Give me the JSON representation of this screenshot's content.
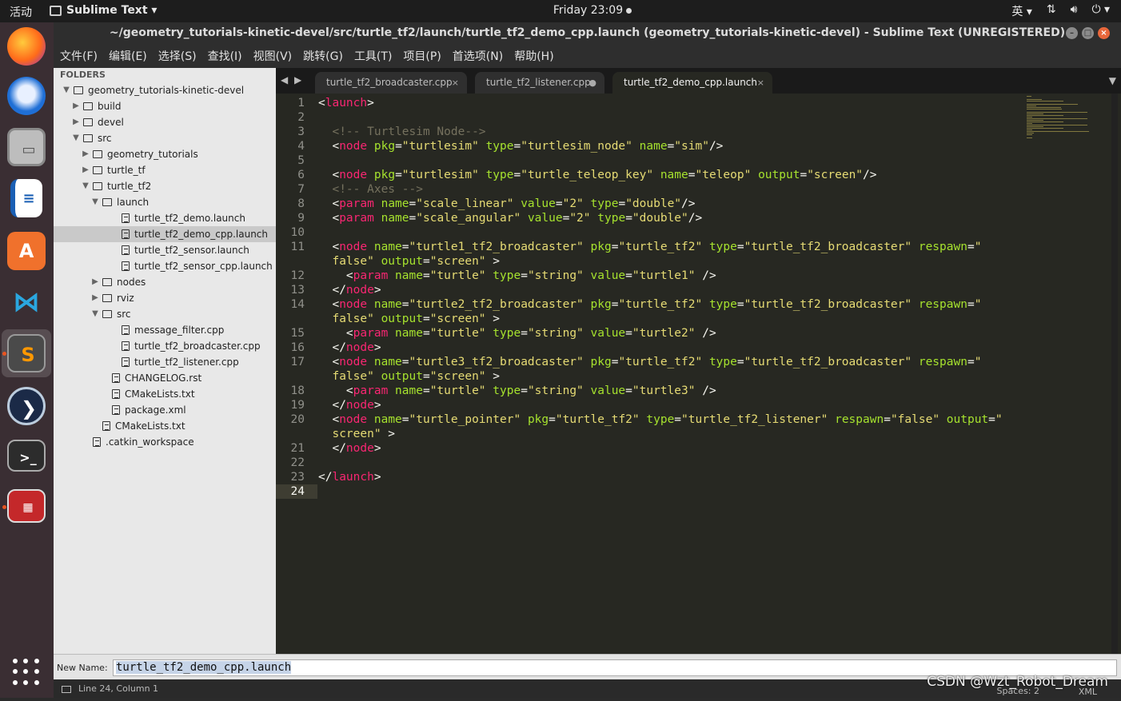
{
  "topbar": {
    "activities": "活动",
    "app_name": "Sublime Text ▾",
    "clock": "Friday 23:09",
    "ime": "英 ▾",
    "tray_icons": [
      "network-icon",
      "volume-icon",
      "power-icon"
    ]
  },
  "window": {
    "title": "~/geometry_tutorials-kinetic-devel/src/turtle_tf2/launch/turtle_tf2_demo_cpp.launch (geometry_tutorials-kinetic-devel) - Sublime Text (UNREGISTERED)"
  },
  "menu": [
    "文件(F)",
    "编辑(E)",
    "选择(S)",
    "查找(I)",
    "视图(V)",
    "跳转(G)",
    "工具(T)",
    "项目(P)",
    "首选项(N)",
    "帮助(H)"
  ],
  "dock": [
    "firefox-icon",
    "thunderbird-icon",
    "files-icon",
    "writer-icon",
    "software-icon",
    "vscode-icon",
    "sublime-icon",
    "qtcreator-icon",
    "terminal-icon",
    "terminator-icon"
  ],
  "sidebar": {
    "header": "FOLDERS",
    "tree": [
      {
        "label": "geometry_tutorials-kinetic-devel",
        "depth": 0,
        "kind": "folder",
        "open": true
      },
      {
        "label": "build",
        "depth": 1,
        "kind": "folder",
        "open": false
      },
      {
        "label": "devel",
        "depth": 1,
        "kind": "folder",
        "open": false
      },
      {
        "label": "src",
        "depth": 1,
        "kind": "folder",
        "open": true
      },
      {
        "label": "geometry_tutorials",
        "depth": 2,
        "kind": "folder",
        "open": false
      },
      {
        "label": "turtle_tf",
        "depth": 2,
        "kind": "folder",
        "open": false
      },
      {
        "label": "turtle_tf2",
        "depth": 2,
        "kind": "folder",
        "open": true
      },
      {
        "label": "launch",
        "depth": 3,
        "kind": "folder",
        "open": true
      },
      {
        "label": "turtle_tf2_demo.launch",
        "depth": 4,
        "kind": "file"
      },
      {
        "label": "turtle_tf2_demo_cpp.launch",
        "depth": 4,
        "kind": "file",
        "selected": true
      },
      {
        "label": "turtle_tf2_sensor.launch",
        "depth": 4,
        "kind": "file"
      },
      {
        "label": "turtle_tf2_sensor_cpp.launch",
        "depth": 4,
        "kind": "file"
      },
      {
        "label": "nodes",
        "depth": 3,
        "kind": "folder",
        "open": false
      },
      {
        "label": "rviz",
        "depth": 3,
        "kind": "folder",
        "open": false
      },
      {
        "label": "src",
        "depth": 3,
        "kind": "folder",
        "open": true
      },
      {
        "label": "message_filter.cpp",
        "depth": 4,
        "kind": "file"
      },
      {
        "label": "turtle_tf2_broadcaster.cpp",
        "depth": 4,
        "kind": "file"
      },
      {
        "label": "turtle_tf2_listener.cpp",
        "depth": 4,
        "kind": "file"
      },
      {
        "label": "CHANGELOG.rst",
        "depth": 3,
        "kind": "file"
      },
      {
        "label": "CMakeLists.txt",
        "depth": 3,
        "kind": "file"
      },
      {
        "label": "package.xml",
        "depth": 3,
        "kind": "file"
      },
      {
        "label": "CMakeLists.txt",
        "depth": 2,
        "kind": "file"
      },
      {
        "label": ".catkin_workspace",
        "depth": 1,
        "kind": "file"
      }
    ]
  },
  "tabs": [
    {
      "label": "turtle_tf2_broadcaster.cpp",
      "close": "×",
      "active": false
    },
    {
      "label": "turtle_tf2_listener.cpp",
      "close": "●",
      "active": false
    },
    {
      "label": "turtle_tf2_demo_cpp.launch",
      "close": "×",
      "active": true
    }
  ],
  "editor": {
    "current_line": 24,
    "lines": [
      {
        "n": "1",
        "tokens": [
          [
            "p",
            "<"
          ],
          [
            "tg",
            "launch"
          ],
          [
            "p",
            ">"
          ]
        ]
      },
      {
        "n": "2",
        "tokens": []
      },
      {
        "n": "3",
        "tokens": [
          [
            "p",
            "  "
          ],
          [
            "cm",
            "<!-- Turtlesim Node-->"
          ]
        ]
      },
      {
        "n": "4",
        "tokens": [
          [
            "p",
            "  <"
          ],
          [
            "tg",
            "node"
          ],
          [
            "p",
            " "
          ],
          [
            "at",
            "pkg"
          ],
          [
            "p",
            "="
          ],
          [
            "st",
            "\"turtlesim\""
          ],
          [
            "p",
            " "
          ],
          [
            "at",
            "type"
          ],
          [
            "p",
            "="
          ],
          [
            "st",
            "\"turtlesim_node\""
          ],
          [
            "p",
            " "
          ],
          [
            "at",
            "name"
          ],
          [
            "p",
            "="
          ],
          [
            "st",
            "\"sim\""
          ],
          [
            "p",
            "/>"
          ]
        ]
      },
      {
        "n": "5",
        "tokens": []
      },
      {
        "n": "6",
        "tokens": [
          [
            "p",
            "  <"
          ],
          [
            "tg",
            "node"
          ],
          [
            "p",
            " "
          ],
          [
            "at",
            "pkg"
          ],
          [
            "p",
            "="
          ],
          [
            "st",
            "\"turtlesim\""
          ],
          [
            "p",
            " "
          ],
          [
            "at",
            "type"
          ],
          [
            "p",
            "="
          ],
          [
            "st",
            "\"turtle_teleop_key\""
          ],
          [
            "p",
            " "
          ],
          [
            "at",
            "name"
          ],
          [
            "p",
            "="
          ],
          [
            "st",
            "\"teleop\""
          ],
          [
            "p",
            " "
          ],
          [
            "at",
            "output"
          ],
          [
            "p",
            "="
          ],
          [
            "st",
            "\"screen\""
          ],
          [
            "p",
            "/>"
          ]
        ]
      },
      {
        "n": "7",
        "tokens": [
          [
            "p",
            "  "
          ],
          [
            "cm",
            "<!-- Axes -->"
          ]
        ]
      },
      {
        "n": "8",
        "tokens": [
          [
            "p",
            "  <"
          ],
          [
            "tg",
            "param"
          ],
          [
            "p",
            " "
          ],
          [
            "at",
            "name"
          ],
          [
            "p",
            "="
          ],
          [
            "st",
            "\"scale_linear\""
          ],
          [
            "p",
            " "
          ],
          [
            "at",
            "value"
          ],
          [
            "p",
            "="
          ],
          [
            "st",
            "\"2\""
          ],
          [
            "p",
            " "
          ],
          [
            "at",
            "type"
          ],
          [
            "p",
            "="
          ],
          [
            "st",
            "\"double\""
          ],
          [
            "p",
            "/>"
          ]
        ]
      },
      {
        "n": "9",
        "tokens": [
          [
            "p",
            "  <"
          ],
          [
            "tg",
            "param"
          ],
          [
            "p",
            " "
          ],
          [
            "at",
            "name"
          ],
          [
            "p",
            "="
          ],
          [
            "st",
            "\"scale_angular\""
          ],
          [
            "p",
            " "
          ],
          [
            "at",
            "value"
          ],
          [
            "p",
            "="
          ],
          [
            "st",
            "\"2\""
          ],
          [
            "p",
            " "
          ],
          [
            "at",
            "type"
          ],
          [
            "p",
            "="
          ],
          [
            "st",
            "\"double\""
          ],
          [
            "p",
            "/>"
          ]
        ]
      },
      {
        "n": "10",
        "tokens": []
      },
      {
        "n": "11",
        "tokens": [
          [
            "p",
            "  <"
          ],
          [
            "tg",
            "node"
          ],
          [
            "p",
            " "
          ],
          [
            "at",
            "name"
          ],
          [
            "p",
            "="
          ],
          [
            "st",
            "\"turtle1_tf2_broadcaster\""
          ],
          [
            "p",
            " "
          ],
          [
            "at",
            "pkg"
          ],
          [
            "p",
            "="
          ],
          [
            "st",
            "\"turtle_tf2\""
          ],
          [
            "p",
            " "
          ],
          [
            "at",
            "type"
          ],
          [
            "p",
            "="
          ],
          [
            "st",
            "\"turtle_tf2_broadcaster\""
          ],
          [
            "p",
            " "
          ],
          [
            "at",
            "respawn"
          ],
          [
            "p",
            "="
          ],
          [
            "st",
            "\""
          ]
        ]
      },
      {
        "n": "",
        "tokens": [
          [
            "st",
            "  false\""
          ],
          [
            "p",
            " "
          ],
          [
            "at",
            "output"
          ],
          [
            "p",
            "="
          ],
          [
            "st",
            "\"screen\""
          ],
          [
            "p",
            " >"
          ]
        ]
      },
      {
        "n": "12",
        "tokens": [
          [
            "p",
            "    <"
          ],
          [
            "tg",
            "param"
          ],
          [
            "p",
            " "
          ],
          [
            "at",
            "name"
          ],
          [
            "p",
            "="
          ],
          [
            "st",
            "\"turtle\""
          ],
          [
            "p",
            " "
          ],
          [
            "at",
            "type"
          ],
          [
            "p",
            "="
          ],
          [
            "st",
            "\"string\""
          ],
          [
            "p",
            " "
          ],
          [
            "at",
            "value"
          ],
          [
            "p",
            "="
          ],
          [
            "st",
            "\"turtle1\""
          ],
          [
            "p",
            " />"
          ]
        ]
      },
      {
        "n": "13",
        "tokens": [
          [
            "p",
            "  </"
          ],
          [
            "tg",
            "node"
          ],
          [
            "p",
            ">"
          ]
        ]
      },
      {
        "n": "14",
        "tokens": [
          [
            "p",
            "  <"
          ],
          [
            "tg",
            "node"
          ],
          [
            "p",
            " "
          ],
          [
            "at",
            "name"
          ],
          [
            "p",
            "="
          ],
          [
            "st",
            "\"turtle2_tf2_broadcaster\""
          ],
          [
            "p",
            " "
          ],
          [
            "at",
            "pkg"
          ],
          [
            "p",
            "="
          ],
          [
            "st",
            "\"turtle_tf2\""
          ],
          [
            "p",
            " "
          ],
          [
            "at",
            "type"
          ],
          [
            "p",
            "="
          ],
          [
            "st",
            "\"turtle_tf2_broadcaster\""
          ],
          [
            "p",
            " "
          ],
          [
            "at",
            "respawn"
          ],
          [
            "p",
            "="
          ],
          [
            "st",
            "\""
          ]
        ]
      },
      {
        "n": "",
        "tokens": [
          [
            "st",
            "  false\""
          ],
          [
            "p",
            " "
          ],
          [
            "at",
            "output"
          ],
          [
            "p",
            "="
          ],
          [
            "st",
            "\"screen\""
          ],
          [
            "p",
            " >"
          ]
        ]
      },
      {
        "n": "15",
        "tokens": [
          [
            "p",
            "    <"
          ],
          [
            "tg",
            "param"
          ],
          [
            "p",
            " "
          ],
          [
            "at",
            "name"
          ],
          [
            "p",
            "="
          ],
          [
            "st",
            "\"turtle\""
          ],
          [
            "p",
            " "
          ],
          [
            "at",
            "type"
          ],
          [
            "p",
            "="
          ],
          [
            "st",
            "\"string\""
          ],
          [
            "p",
            " "
          ],
          [
            "at",
            "value"
          ],
          [
            "p",
            "="
          ],
          [
            "st",
            "\"turtle2\""
          ],
          [
            "p",
            " />"
          ]
        ]
      },
      {
        "n": "16",
        "tokens": [
          [
            "p",
            "  </"
          ],
          [
            "tg",
            "node"
          ],
          [
            "p",
            ">"
          ]
        ]
      },
      {
        "n": "17",
        "tokens": [
          [
            "p",
            "  <"
          ],
          [
            "tg",
            "node"
          ],
          [
            "p",
            " "
          ],
          [
            "at",
            "name"
          ],
          [
            "p",
            "="
          ],
          [
            "st",
            "\"turtle3_tf2_broadcaster\""
          ],
          [
            "p",
            " "
          ],
          [
            "at",
            "pkg"
          ],
          [
            "p",
            "="
          ],
          [
            "st",
            "\"turtle_tf2\""
          ],
          [
            "p",
            " "
          ],
          [
            "at",
            "type"
          ],
          [
            "p",
            "="
          ],
          [
            "st",
            "\"turtle_tf2_broadcaster\""
          ],
          [
            "p",
            " "
          ],
          [
            "at",
            "respawn"
          ],
          [
            "p",
            "="
          ],
          [
            "st",
            "\""
          ]
        ]
      },
      {
        "n": "",
        "tokens": [
          [
            "st",
            "  false\""
          ],
          [
            "p",
            " "
          ],
          [
            "at",
            "output"
          ],
          [
            "p",
            "="
          ],
          [
            "st",
            "\"screen\""
          ],
          [
            "p",
            " >"
          ]
        ]
      },
      {
        "n": "18",
        "tokens": [
          [
            "p",
            "    <"
          ],
          [
            "tg",
            "param"
          ],
          [
            "p",
            " "
          ],
          [
            "at",
            "name"
          ],
          [
            "p",
            "="
          ],
          [
            "st",
            "\"turtle\""
          ],
          [
            "p",
            " "
          ],
          [
            "at",
            "type"
          ],
          [
            "p",
            "="
          ],
          [
            "st",
            "\"string\""
          ],
          [
            "p",
            " "
          ],
          [
            "at",
            "value"
          ],
          [
            "p",
            "="
          ],
          [
            "st",
            "\"turtle3\""
          ],
          [
            "p",
            " />"
          ]
        ]
      },
      {
        "n": "19",
        "tokens": [
          [
            "p",
            "  </"
          ],
          [
            "tg",
            "node"
          ],
          [
            "p",
            ">"
          ]
        ]
      },
      {
        "n": "20",
        "tokens": [
          [
            "p",
            "  <"
          ],
          [
            "tg",
            "node"
          ],
          [
            "p",
            " "
          ],
          [
            "at",
            "name"
          ],
          [
            "p",
            "="
          ],
          [
            "st",
            "\"turtle_pointer\""
          ],
          [
            "p",
            " "
          ],
          [
            "at",
            "pkg"
          ],
          [
            "p",
            "="
          ],
          [
            "st",
            "\"turtle_tf2\""
          ],
          [
            "p",
            " "
          ],
          [
            "at",
            "type"
          ],
          [
            "p",
            "="
          ],
          [
            "st",
            "\"turtle_tf2_listener\""
          ],
          [
            "p",
            " "
          ],
          [
            "at",
            "respawn"
          ],
          [
            "p",
            "="
          ],
          [
            "st",
            "\"false\""
          ],
          [
            "p",
            " "
          ],
          [
            "at",
            "output"
          ],
          [
            "p",
            "="
          ],
          [
            "st",
            "\""
          ]
        ]
      },
      {
        "n": "",
        "tokens": [
          [
            "st",
            "  screen\""
          ],
          [
            "p",
            " >"
          ]
        ]
      },
      {
        "n": "21",
        "tokens": [
          [
            "p",
            "  </"
          ],
          [
            "tg",
            "node"
          ],
          [
            "p",
            ">"
          ]
        ]
      },
      {
        "n": "22",
        "tokens": []
      },
      {
        "n": "23",
        "tokens": [
          [
            "p",
            "</"
          ],
          [
            "tg",
            "launch"
          ],
          [
            "p",
            ">"
          ]
        ]
      },
      {
        "n": "24",
        "tokens": []
      }
    ]
  },
  "input_panel": {
    "label": "New Name:",
    "value": "turtle_tf2_demo_cpp.launch"
  },
  "statusbar": {
    "position": "Line 24, Column 1",
    "spaces": "Spaces: 2",
    "syntax": "XML"
  },
  "watermark": "CSDN @Wzt_Robot_Dream",
  "colors": {
    "tag": "#f92672",
    "attr": "#a6e22e",
    "string": "#e6db74",
    "comment": "#75715e",
    "editor_bg": "#272822"
  }
}
